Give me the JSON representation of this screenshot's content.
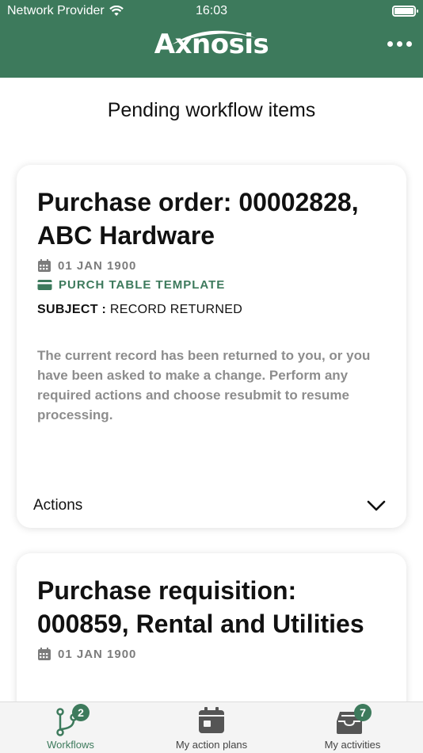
{
  "status_bar": {
    "carrier": "Network Provider",
    "time": "16:03"
  },
  "header": {
    "logo_text": "Axnosis"
  },
  "page": {
    "title": "Pending workflow items"
  },
  "cards": [
    {
      "title": "Purchase order: 00002828, ABC Hardware",
      "date": "01 JAN 1900",
      "template": "PURCH TABLE TEMPLATE",
      "subject_label": "SUBJECT :",
      "subject_value": "RECORD RETURNED",
      "description": "The current record has been returned to you, or you have been asked to make a change. Perform any required actions and choose resubmit to resume processing.",
      "actions_label": "Actions"
    },
    {
      "title": "Purchase requisition: 000859, Rental and Utilities",
      "date": "01 JAN 1900"
    }
  ],
  "tabbar": {
    "tabs": [
      {
        "label": "Workflows",
        "badge": "2",
        "icon": "workflow-branch-icon",
        "active": true
      },
      {
        "label": "My action plans",
        "icon": "calendar-icon"
      },
      {
        "label": "My activities",
        "badge": "7",
        "icon": "inbox-tray-icon"
      }
    ]
  },
  "colors": {
    "brand": "#3d7a5c",
    "muted": "#8d8d8d"
  }
}
